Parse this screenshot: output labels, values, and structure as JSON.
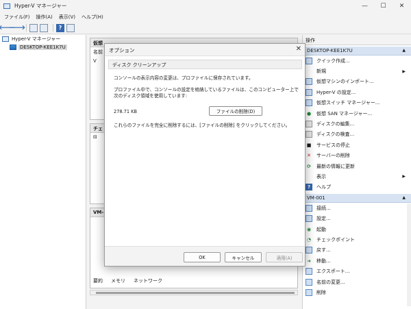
{
  "window": {
    "title": "Hyper-V マネージャー",
    "minimize": "—",
    "maximize": "☐",
    "close": "✕"
  },
  "menu": [
    "ファイル(F)",
    "操作(A)",
    "表示(V)",
    "ヘルプ(H)"
  ],
  "tree": {
    "root": "Hyper-V マネージャー",
    "server": "DESKTOP-KEE1K7U"
  },
  "center": {
    "vm_section_head": "仮想",
    "vm_col_name": "名前",
    "vm_row_initial": "V",
    "checkpoint_head": "チェ",
    "checkpoint_tree_mark": "⊟",
    "detail_head": "VM-",
    "tabs": [
      "要約",
      "メモリ",
      "ネットワーク"
    ]
  },
  "actions": {
    "title": "操作",
    "groups": [
      {
        "header": "DESKTOP-KEE1K7U",
        "items": [
          {
            "label": "クイック作成...",
            "icon": "quick-create-icon"
          },
          {
            "label": "新規",
            "icon": "new-icon",
            "submenu": true
          },
          {
            "label": "仮想マシンのインポート...",
            "icon": "import-vm-icon"
          },
          {
            "label": "Hyper-V の設定...",
            "icon": "hyperv-settings-icon"
          },
          {
            "label": "仮想スイッチ マネージャー...",
            "icon": "virtual-switch-icon"
          },
          {
            "label": "仮想 SAN マネージャー...",
            "icon": "virtual-san-icon"
          },
          {
            "label": "ディスクの編集...",
            "icon": "edit-disk-icon"
          },
          {
            "label": "ディスクの検査...",
            "icon": "inspect-disk-icon"
          },
          {
            "label": "サービスの停止",
            "icon": "stop-service-icon"
          },
          {
            "label": "サーバーの削除",
            "icon": "remove-server-icon"
          },
          {
            "label": "最新の情報に更新",
            "icon": "refresh-icon"
          },
          {
            "label": "表示",
            "icon": "view-icon",
            "submenu": true
          },
          {
            "label": "ヘルプ",
            "icon": "help-icon"
          }
        ]
      },
      {
        "header": "VM-001",
        "items": [
          {
            "label": "接続...",
            "icon": "connect-icon"
          },
          {
            "label": "設定...",
            "icon": "settings-icon"
          },
          {
            "label": "起動",
            "icon": "start-icon"
          },
          {
            "label": "チェックポイント",
            "icon": "checkpoint-icon"
          },
          {
            "label": "戻す...",
            "icon": "revert-icon"
          },
          {
            "label": "移動...",
            "icon": "move-icon"
          },
          {
            "label": "エクスポート...",
            "icon": "export-icon"
          },
          {
            "label": "名前の変更...",
            "icon": "rename-icon"
          },
          {
            "label": "削除",
            "icon": "delete-icon"
          }
        ]
      }
    ]
  },
  "dialog": {
    "title": "オプション",
    "tab": "ディスク クリーンアップ",
    "text1": "コンソールの表示内容の変更は、プロファイルに保存されています。",
    "text2": "プロファイル中で、コンソールの設定を格納しているファイルは、このコンピューター上で次のディスク領域を使用しています:",
    "size": "278.71 KB",
    "delete_button": "ファイルの削除(D)",
    "text3": "これらのファイルを完全に削除するには、[ファイルの削除] をクリックしてください。",
    "ok": "OK",
    "cancel": "キャンセル",
    "apply": "適用(A)"
  }
}
